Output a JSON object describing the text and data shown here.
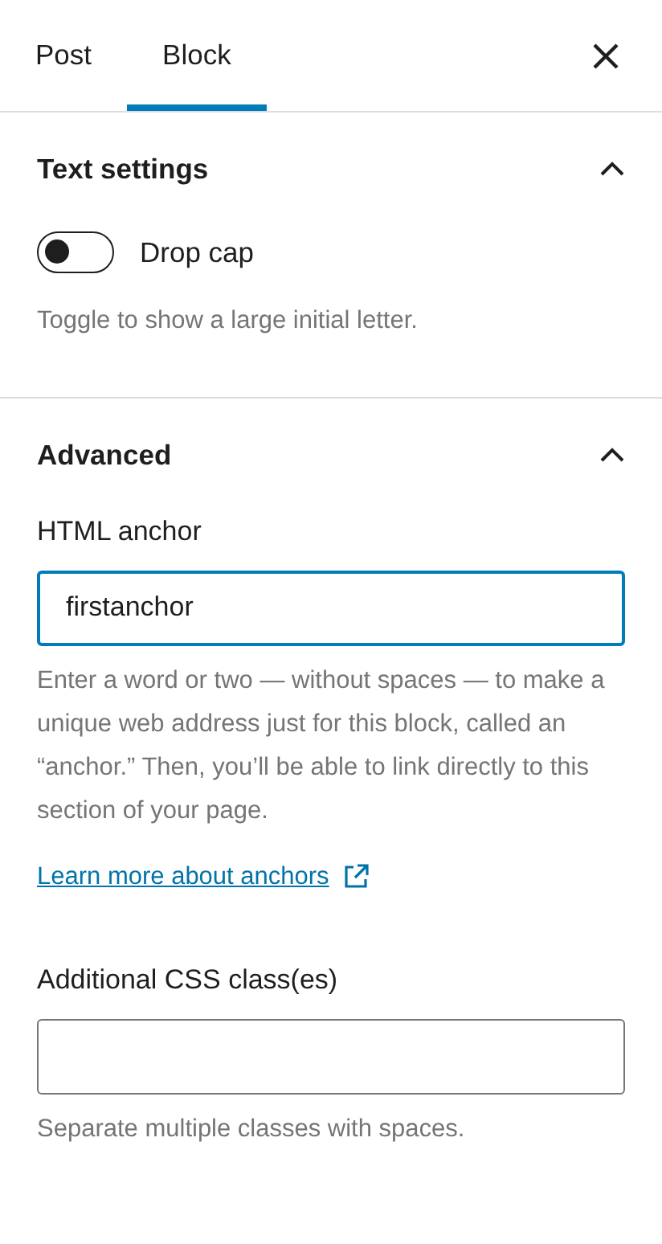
{
  "tabs": [
    {
      "label": "Post",
      "selected": false
    },
    {
      "label": "Block",
      "selected": true
    }
  ],
  "panels": [
    {
      "title": "Text settings",
      "expanded": true,
      "controls": [
        {
          "kind": "toggle",
          "label": "Drop cap",
          "on": false,
          "help": "Toggle to show a large initial letter."
        }
      ]
    },
    {
      "title": "Advanced",
      "expanded": true,
      "controls": [
        {
          "kind": "text",
          "label": "HTML anchor",
          "value": "firstanchor",
          "focused": true,
          "help": "Enter a word or two — without spaces — to make a unique web address just for this block, called an “anchor.” Then, you’ll be able to link directly to this section of your page.",
          "link": "Learn more about anchors"
        },
        {
          "kind": "text",
          "label": "Additional CSS class(es)",
          "focused": false,
          "help": "Separate multiple classes with spaces."
        }
      ]
    }
  ]
}
